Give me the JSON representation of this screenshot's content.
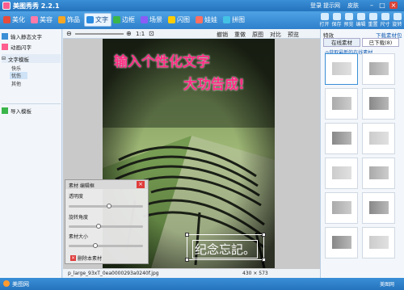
{
  "app": {
    "title": "美图秀秀 2.2.1",
    "links": [
      "登录",
      "提示网",
      "皮肤"
    ]
  },
  "tabs": [
    {
      "label": "美化",
      "color": "#e64b3c"
    },
    {
      "label": "美容",
      "color": "#ff7aa8"
    },
    {
      "label": "饰品",
      "color": "#f5a623"
    },
    {
      "label": "文字",
      "color": "#2b8be0"
    },
    {
      "label": "边框",
      "color": "#3ab54a"
    },
    {
      "label": "场景",
      "color": "#8b5cf6"
    },
    {
      "label": "闪图",
      "color": "#ffcc00"
    },
    {
      "label": "娃娃",
      "color": "#ff6f61"
    },
    {
      "label": "拼图",
      "color": "#44c2e5"
    }
  ],
  "toolbar_right": [
    "打开",
    "保存",
    "预览",
    "编辑",
    "重置",
    "尺寸",
    "旋转"
  ],
  "left": {
    "btn1": "输入静态文字",
    "btn2": "动画闪字",
    "tree_root": "文字模板",
    "tree_items": [
      "快乐",
      "忧伤",
      "其他"
    ],
    "selected": "忧伤",
    "import": "导入模板"
  },
  "canvasbar": {
    "zoom": "1:1",
    "actions": [
      "撤销",
      "重做",
      "原图",
      "对比",
      "预览"
    ]
  },
  "photo": {
    "line1": "输入个性化文字",
    "line2": "大功告成!",
    "stamp": "纪念忘記。"
  },
  "material": {
    "title": "素材 编辑框",
    "opacity": "透明度",
    "rotate": "旋转角度",
    "size": "素材大小",
    "delete": "删除本素材",
    "opacity_val": 0.55,
    "rotate_val": 0.4,
    "size_val": 0.35
  },
  "status": {
    "file": "p_large_93xT_0ea0000293a0240f.jpg",
    "dims": "430 × 573"
  },
  "right": {
    "header": "特效",
    "link": "下载素材包",
    "tab1": "在线素材",
    "tab2": "已下载(8)",
    "promo": "◎获取最新的在线素材"
  },
  "bottom": {
    "left": "美图网",
    "right": "美图网"
  }
}
